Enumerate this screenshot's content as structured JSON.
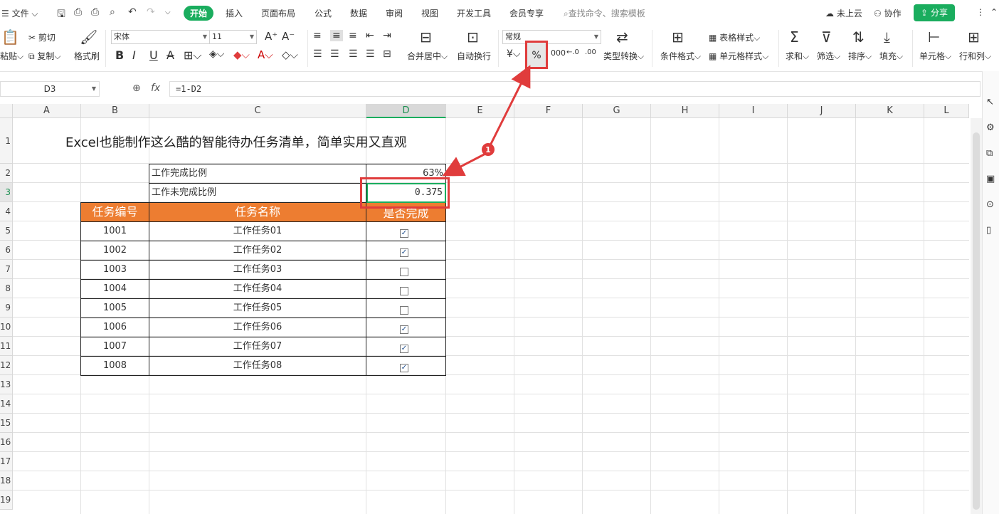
{
  "menu": {
    "file": "文件",
    "tabs": [
      "开始",
      "插入",
      "页面布局",
      "公式",
      "数据",
      "审阅",
      "视图",
      "开发工具",
      "会员专享"
    ],
    "search_placeholder": "查找命令、搜索模板",
    "cloud": "未上云",
    "collab": "协作",
    "share": "分享"
  },
  "ribbon": {
    "paste": "粘贴",
    "cut": "剪切",
    "copy": "复制",
    "format_painter": "格式刷",
    "font_name": "宋体",
    "font_size": "11",
    "bold": "B",
    "italic": "I",
    "underline": "U",
    "strike": "A",
    "merge_center": "合并居中",
    "wrap": "自动换行",
    "number_format": "常规",
    "currency": "¥",
    "percent": "%",
    "thousands": "000",
    "inc_dec": "←.0",
    "dec_dec": ".00",
    "type_convert": "类型转换",
    "cond_format": "条件格式",
    "table_style": "表格样式",
    "cell_style": "单元格样式",
    "sum": "求和",
    "filter": "筛选",
    "sort": "排序",
    "fill": "填充",
    "cell": "单元格",
    "row_col": "行和列"
  },
  "formula_bar": {
    "name_box": "D3",
    "fx": "fx",
    "formula": "=1-D2"
  },
  "grid": {
    "columns": [
      "A",
      "B",
      "C",
      "D",
      "E",
      "F",
      "G",
      "H",
      "I",
      "J",
      "K",
      "L"
    ],
    "rows": [
      "1",
      "2",
      "3",
      "4",
      "5",
      "6",
      "7",
      "8",
      "9",
      "10",
      "11",
      "12",
      "13",
      "14",
      "15",
      "16",
      "17",
      "18",
      "19"
    ],
    "title": "Excel也能制作这么酷的智能待办任务清单，简单实用又直观",
    "done_ratio_label": "工作完成比例",
    "done_ratio_value": "63%",
    "undone_ratio_label": "工作未完成比例",
    "undone_ratio_value": "0.375",
    "headers": [
      "任务编号",
      "任务名称",
      "是否完成"
    ],
    "tasks": [
      {
        "id": "1001",
        "name": "工作任务01",
        "done": true
      },
      {
        "id": "1002",
        "name": "工作任务02",
        "done": true
      },
      {
        "id": "1003",
        "name": "工作任务03",
        "done": false
      },
      {
        "id": "1004",
        "name": "工作任务04",
        "done": false
      },
      {
        "id": "1005",
        "name": "工作任务05",
        "done": false
      },
      {
        "id": "1006",
        "name": "工作任务06",
        "done": true
      },
      {
        "id": "1007",
        "name": "工作任务07",
        "done": true
      },
      {
        "id": "1008",
        "name": "工作任务08",
        "done": true
      }
    ]
  },
  "annotation": {
    "marker": "1",
    "color": "#e03c3c"
  },
  "colors": {
    "accent": "#1aad5e",
    "header_fill": "#ed7d31"
  }
}
